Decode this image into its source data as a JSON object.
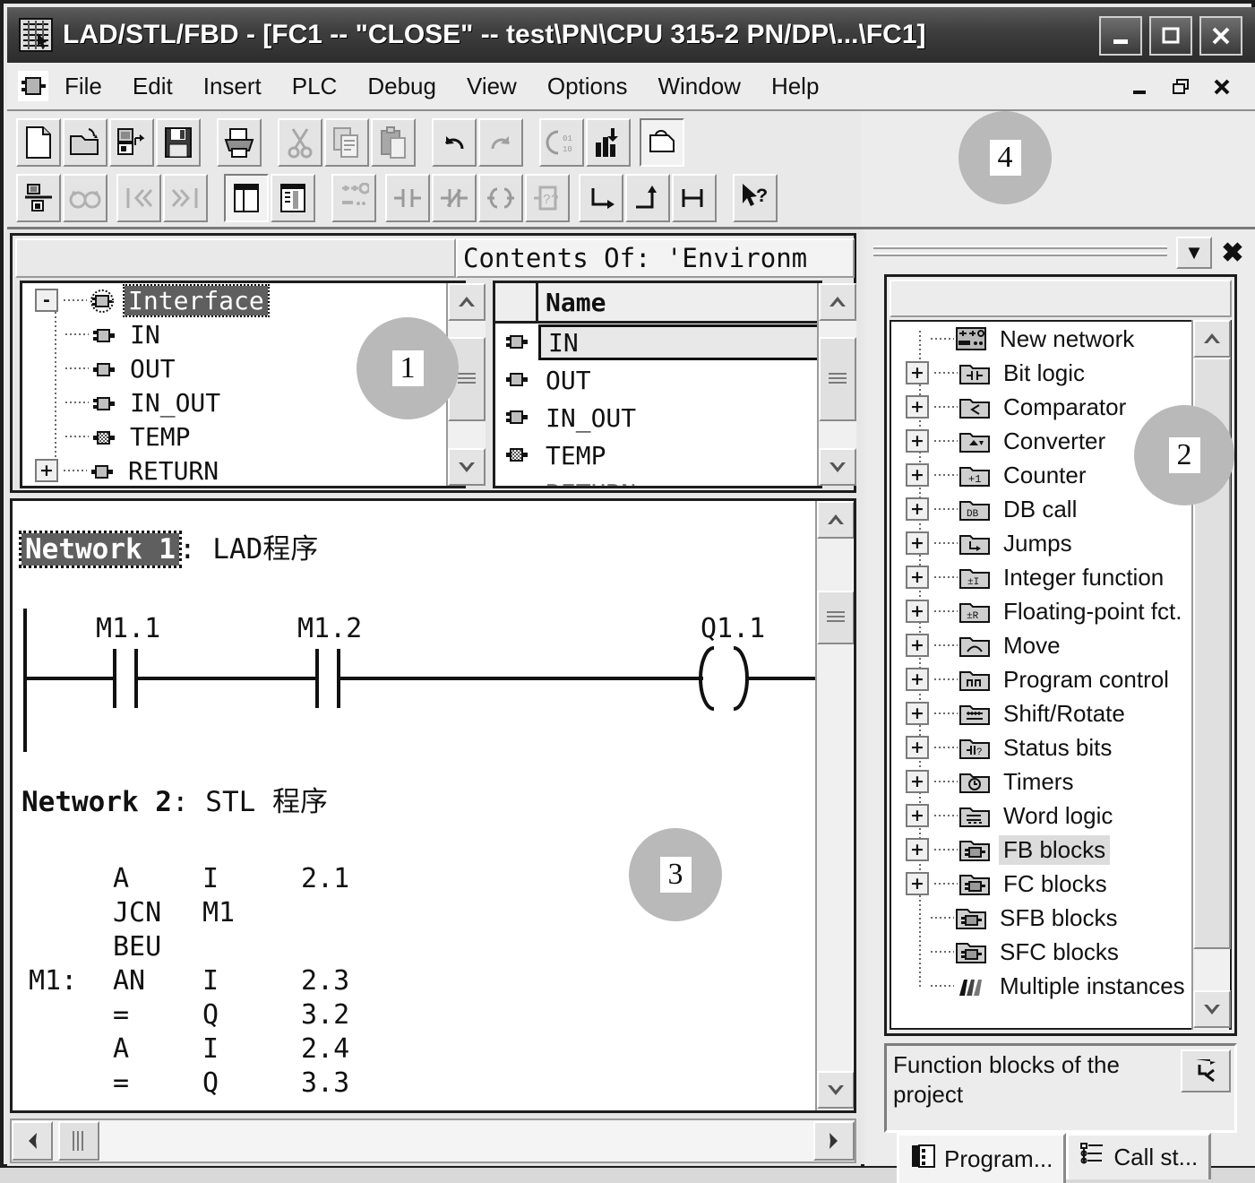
{
  "window": {
    "title": "LAD/STL/FBD  - [FC1 -- \"CLOSE\" -- test\\PN\\CPU 315-2 PN/DP\\...\\FC1]",
    "app_icon": "ladder-logic-icon",
    "buttons": {
      "minimize": "_",
      "maximize": "☐",
      "close": "✕"
    },
    "mdi_buttons": {
      "minimize": "–",
      "restore": "❐",
      "close": "✖"
    }
  },
  "menu": {
    "block_icon": "block-icon",
    "items": [
      {
        "label": "File"
      },
      {
        "label": "Edit"
      },
      {
        "label": "Insert"
      },
      {
        "label": "PLC"
      },
      {
        "label": "Debug"
      },
      {
        "label": "View"
      },
      {
        "label": "Options"
      },
      {
        "label": "Window"
      },
      {
        "label": "Help"
      }
    ]
  },
  "toolbar": {
    "row1": [
      {
        "name": "new-file-icon",
        "pressed": false
      },
      {
        "name": "open-file-icon",
        "pressed": false
      },
      {
        "name": "save-as-icon",
        "pressed": false
      },
      {
        "name": "save-icon",
        "pressed": false
      },
      {
        "name": "print-icon",
        "pressed": false
      },
      {
        "name": "cut-icon",
        "pressed": false
      },
      {
        "name": "copy-icon",
        "pressed": false
      },
      {
        "name": "paste-icon",
        "pressed": false
      },
      {
        "name": "undo-icon",
        "pressed": false
      },
      {
        "name": "redo-icon",
        "pressed": false
      },
      {
        "name": "download-icon",
        "pressed": false
      },
      {
        "name": "monitor-icon",
        "pressed": false
      },
      {
        "name": "overview-icon",
        "pressed": true
      }
    ],
    "row2": [
      {
        "name": "symbol-table-icon",
        "pressed": false
      },
      {
        "name": "glasses-icon",
        "pressed": false
      },
      {
        "name": "prev-error-icon",
        "pressed": false
      },
      {
        "name": "next-error-icon",
        "pressed": false
      },
      {
        "name": "declaration-view-icon",
        "pressed": true
      },
      {
        "name": "symbolic-repr-icon",
        "pressed": false
      },
      {
        "name": "new-network-icon",
        "pressed": false
      },
      {
        "name": "no-contact-icon",
        "pressed": false
      },
      {
        "name": "nc-contact-icon",
        "pressed": false
      },
      {
        "name": "output-coil-icon",
        "pressed": false
      },
      {
        "name": "empty-box-icon",
        "pressed": false
      },
      {
        "name": "branch-open-icon",
        "pressed": false
      },
      {
        "name": "branch-close-icon",
        "pressed": false
      },
      {
        "name": "open-branch-icon",
        "pressed": false
      },
      {
        "name": "help-pointer-icon",
        "pressed": false
      }
    ]
  },
  "declaration": {
    "left_header": "",
    "contents_header": "Contents Of: 'Environm",
    "tree": [
      {
        "label": "Interface",
        "expander": "-",
        "icon": "interface-icon",
        "selected": true,
        "level": 0
      },
      {
        "label": "IN",
        "expander": "",
        "icon": "in-var-icon",
        "selected": false,
        "level": 1
      },
      {
        "label": "OUT",
        "expander": "",
        "icon": "out-var-icon",
        "selected": false,
        "level": 1
      },
      {
        "label": "IN_OUT",
        "expander": "",
        "icon": "inout-var-icon",
        "selected": false,
        "level": 1
      },
      {
        "label": "TEMP",
        "expander": "",
        "icon": "temp-var-icon",
        "selected": false,
        "level": 1
      },
      {
        "label": "RETURN",
        "expander": "+",
        "icon": "return-var-icon",
        "selected": false,
        "level": 1
      }
    ],
    "list": {
      "column_header": "Name",
      "rows": [
        {
          "name": "IN",
          "icon": "in-var-icon",
          "selected": true
        },
        {
          "name": "OUT",
          "icon": "out-var-icon",
          "selected": false
        },
        {
          "name": "IN_OUT",
          "icon": "inout-var-icon",
          "selected": false
        },
        {
          "name": "TEMP",
          "icon": "temp-var-icon",
          "selected": false
        },
        {
          "name": "RETURN",
          "icon": "return-var-icon",
          "selected": false
        }
      ]
    }
  },
  "code": {
    "network1": {
      "number_label": "Network 1",
      "title": ": LAD程序",
      "selected": true,
      "ladder": {
        "contacts": [
          {
            "label": "M1.1",
            "type": "no-contact"
          },
          {
            "label": "M1.2",
            "type": "no-contact"
          }
        ],
        "coil": {
          "label": "Q1.1",
          "type": "output-coil"
        }
      }
    },
    "network2": {
      "number_label": "Network 2",
      "title": ": STL 程序",
      "selected": false,
      "stl_lines": [
        {
          "label": "",
          "op": "A",
          "operand": "I",
          "address": "2.1"
        },
        {
          "label": "",
          "op": "JCN",
          "operand": "M1",
          "address": ""
        },
        {
          "label": "",
          "op": "BEU",
          "operand": "",
          "address": ""
        },
        {
          "label": "M1:",
          "op": "AN",
          "operand": "I",
          "address": "2.3"
        },
        {
          "label": "",
          "op": "=",
          "operand": "Q",
          "address": "3.2"
        },
        {
          "label": "",
          "op": "A",
          "operand": "I",
          "address": "2.4"
        },
        {
          "label": "",
          "op": "=",
          "operand": "Q",
          "address": "3.3"
        }
      ]
    }
  },
  "program_elements": {
    "dock": {
      "dropdown_glyph": "▼",
      "close_glyph": "✖"
    },
    "items": [
      {
        "label": "New network",
        "expander": "",
        "icon": "new-network-icon",
        "selected": false
      },
      {
        "label": "Bit logic",
        "expander": "+",
        "icon": "bit-logic-folder-icon",
        "selected": false
      },
      {
        "label": "Comparator",
        "expander": "+",
        "icon": "comparator-folder-icon",
        "selected": false
      },
      {
        "label": "Converter",
        "expander": "+",
        "icon": "converter-folder-icon",
        "selected": false
      },
      {
        "label": "Counter",
        "expander": "+",
        "icon": "counter-folder-icon",
        "selected": false
      },
      {
        "label": "DB call",
        "expander": "+",
        "icon": "db-call-folder-icon",
        "selected": false
      },
      {
        "label": "Jumps",
        "expander": "+",
        "icon": "jumps-folder-icon",
        "selected": false
      },
      {
        "label": "Integer function",
        "expander": "+",
        "icon": "integer-folder-icon",
        "selected": false
      },
      {
        "label": "Floating-point fct.",
        "expander": "+",
        "icon": "float-folder-icon",
        "selected": false
      },
      {
        "label": "Move",
        "expander": "+",
        "icon": "move-folder-icon",
        "selected": false
      },
      {
        "label": "Program control",
        "expander": "+",
        "icon": "progctrl-folder-icon",
        "selected": false
      },
      {
        "label": "Shift/Rotate",
        "expander": "+",
        "icon": "shift-folder-icon",
        "selected": false
      },
      {
        "label": "Status bits",
        "expander": "+",
        "icon": "status-folder-icon",
        "selected": false
      },
      {
        "label": "Timers",
        "expander": "+",
        "icon": "timers-folder-icon",
        "selected": false
      },
      {
        "label": "Word logic",
        "expander": "+",
        "icon": "wordlogic-folder-icon",
        "selected": false
      },
      {
        "label": "FB blocks",
        "expander": "+",
        "icon": "fb-block-icon",
        "selected": true
      },
      {
        "label": "FC blocks",
        "expander": "+",
        "icon": "fc-block-icon",
        "selected": false
      },
      {
        "label": "SFB blocks",
        "expander": "",
        "icon": "sfb-block-icon",
        "selected": false
      },
      {
        "label": "SFC blocks",
        "expander": "",
        "icon": "sfc-block-icon",
        "selected": false
      },
      {
        "label": "Multiple instances",
        "expander": "",
        "icon": "multi-instance-icon",
        "selected": false
      }
    ],
    "description": "Function blocks of the project",
    "description_button_icon": "jump-to-icon",
    "tabs": [
      {
        "label": "Program...",
        "icon": "program-elements-icon",
        "active": true
      },
      {
        "label": "Call st...",
        "icon": "call-structure-icon",
        "active": false
      }
    ]
  },
  "callouts": [
    {
      "number": "1"
    },
    {
      "number": "2"
    },
    {
      "number": "3"
    },
    {
      "number": "4"
    }
  ]
}
